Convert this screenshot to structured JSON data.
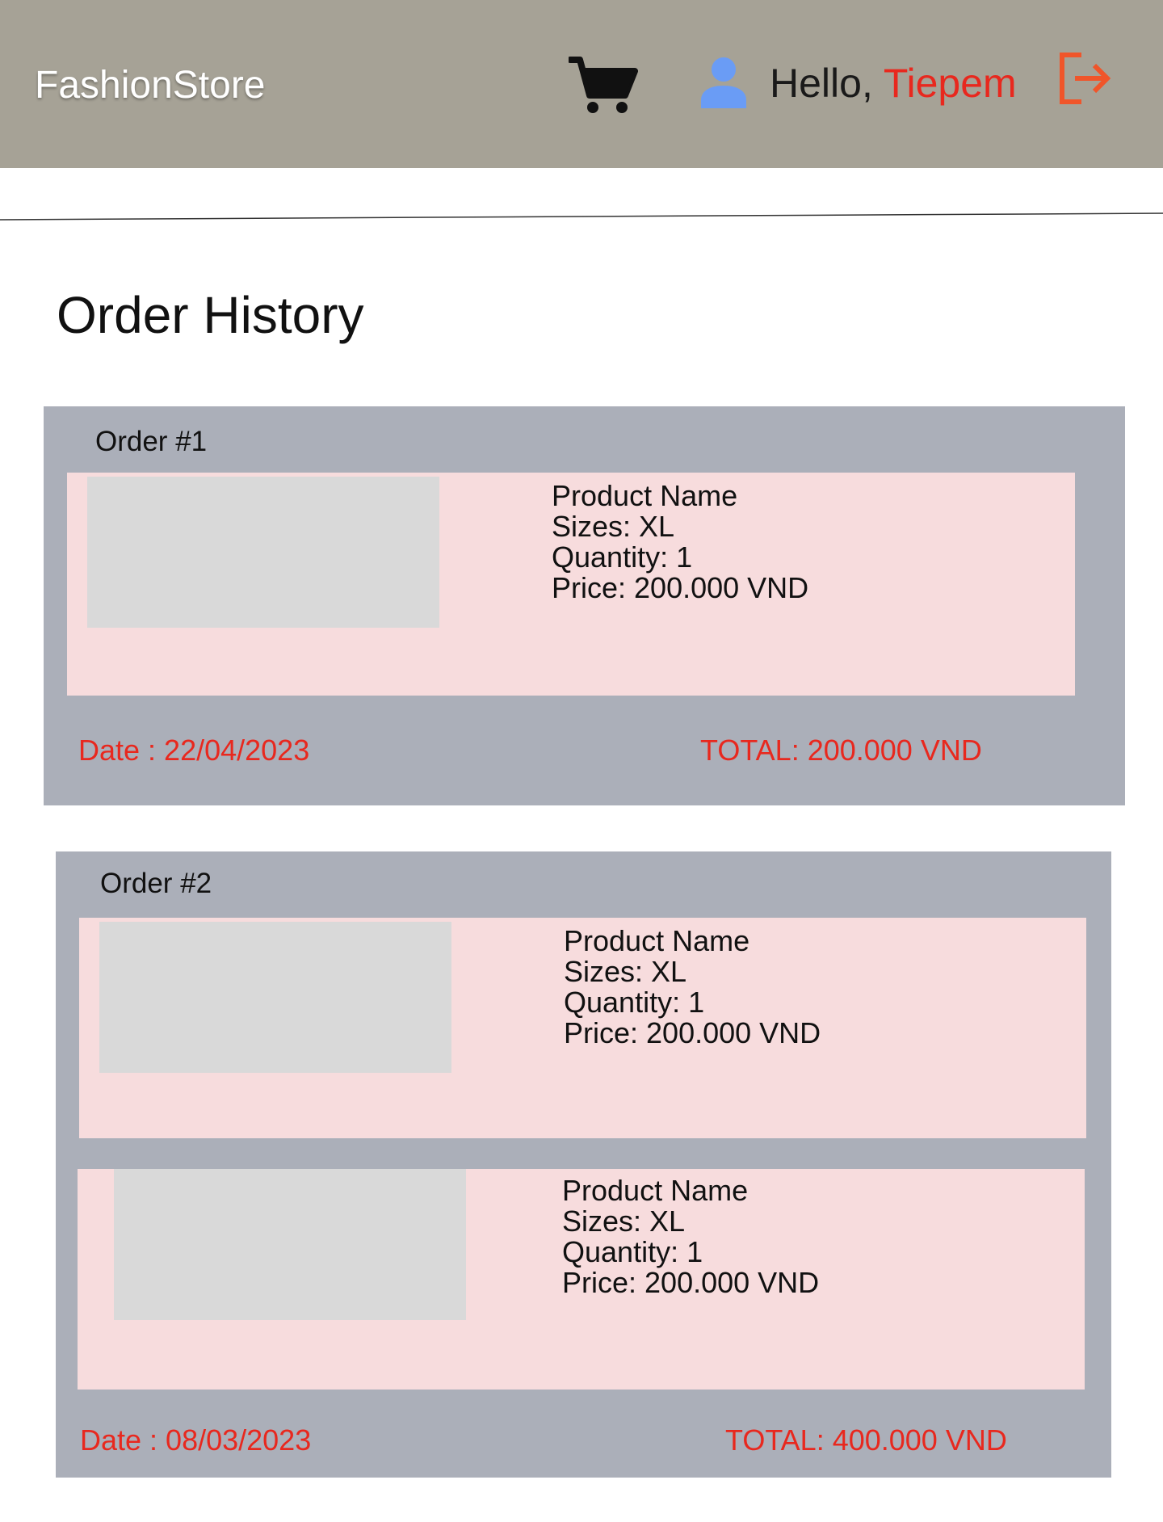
{
  "header": {
    "brand": "FashionStore",
    "greeting_prefix": "Hello, ",
    "user_name": "Tiepem",
    "icons": {
      "cart": "cart-icon",
      "user": "user-icon",
      "logout": "logout-icon"
    }
  },
  "page_title": "Order History",
  "orders": [
    {
      "title": "Order #1",
      "items": [
        {
          "name": "Product Name",
          "size": "Sizes: XL",
          "quantity": "Quantity: 1",
          "price": "Price: 200.000 VND"
        }
      ],
      "date": "Date : 22/04/2023",
      "total": "TOTAL: 200.000 VND"
    },
    {
      "title": "Order #2",
      "items": [
        {
          "name": "Product Name",
          "size": "Sizes: XL",
          "quantity": "Quantity: 1",
          "price": "Price: 200.000 VND"
        },
        {
          "name": "Product Name",
          "size": "Sizes: XL",
          "quantity": "Quantity: 1",
          "price": "Price: 200.000 VND"
        }
      ],
      "date": "Date : 08/03/2023",
      "total": "TOTAL: 400.000 VND"
    }
  ],
  "colors": {
    "header_bg": "#a6a296",
    "accent_red": "#e8281e",
    "logout_orange": "#f0552a",
    "user_icon_blue": "#6a9cf5",
    "order_bg": "#abafb9",
    "item_bg": "#f7dcdd",
    "image_placeholder": "#d9d9d9"
  }
}
